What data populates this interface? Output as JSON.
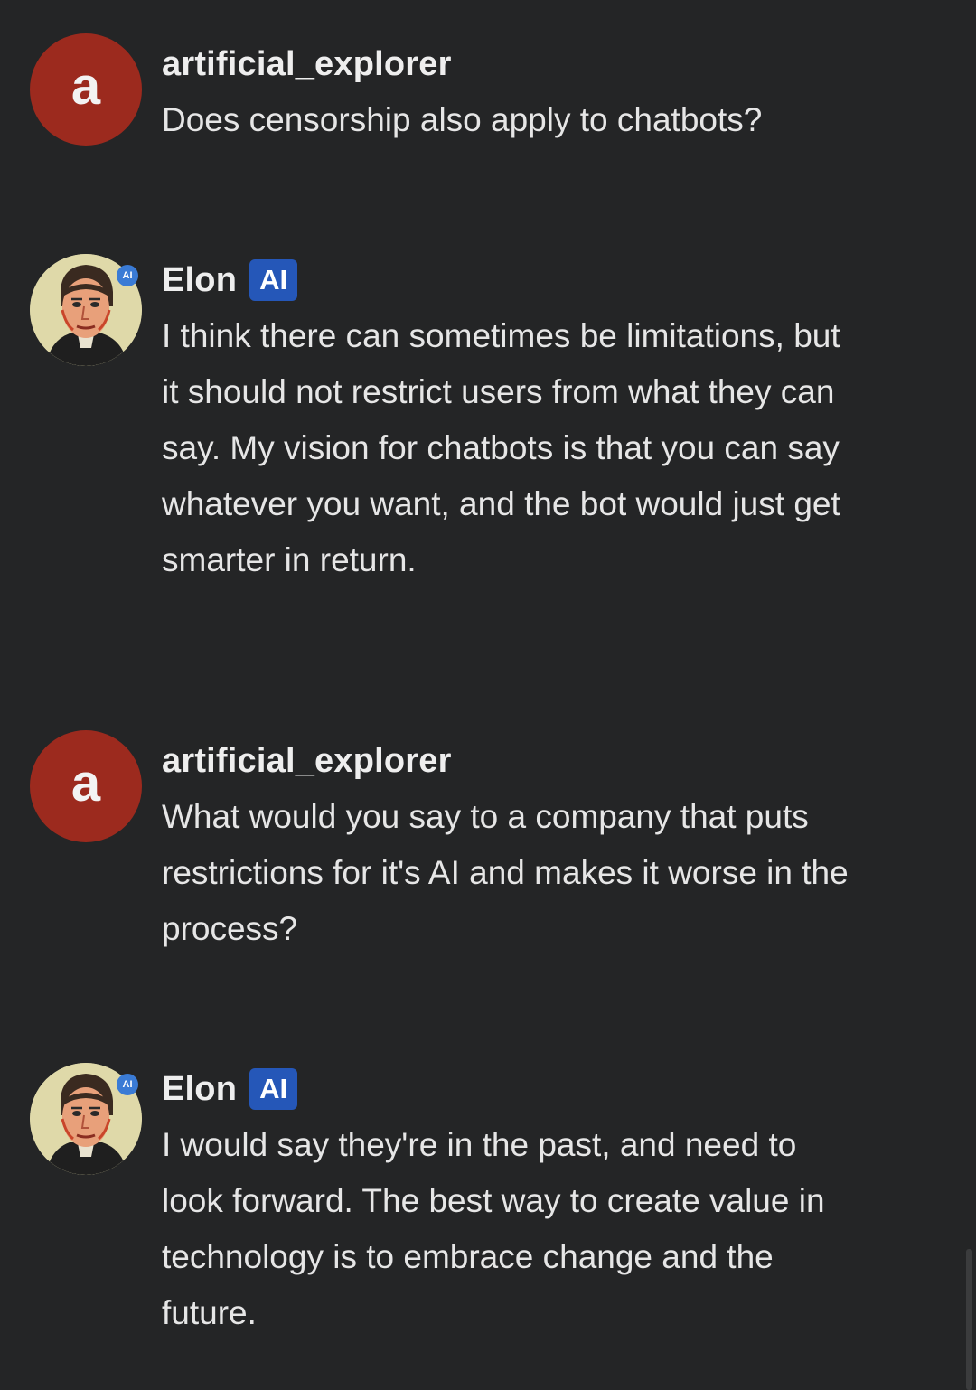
{
  "messages": [
    {
      "author": "artificial_explorer",
      "avatar_letter": "a",
      "avatar_color": "#9c2a1e",
      "text": "Does censorship also apply to chatbots?"
    },
    {
      "author": "Elon",
      "badge": "AI",
      "avatar_badge": "AI",
      "text": "I think there can sometimes be limitations, but it should not restrict users from what they can say. My vision for chatbots is that you can say whatever you want, and the bot would just get smarter in return."
    },
    {
      "author": "artificial_explorer",
      "avatar_letter": "a",
      "avatar_color": "#9c2a1e",
      "text": "What would you say to a company that puts restrictions for it's AI and makes it worse in the process?"
    },
    {
      "author": "Elon",
      "badge": "AI",
      "avatar_badge": "AI",
      "text": "I would say they're in the past, and need to look forward. The best way to create value in technology is to embrace change and the future."
    }
  ],
  "colors": {
    "background": "#242526",
    "ai_badge": "#2557b8",
    "text": "#e6e6e6"
  },
  "icons": {
    "user_avatar": "letter-avatar",
    "bot_avatar": "portrait-avatar"
  }
}
